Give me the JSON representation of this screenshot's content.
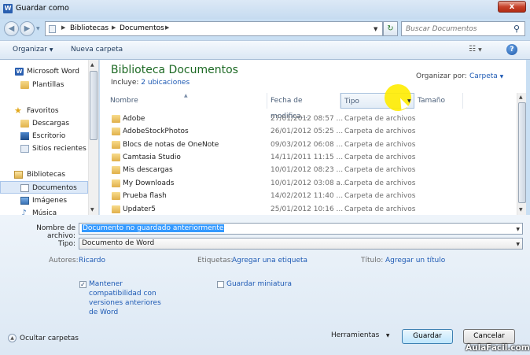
{
  "window": {
    "title": "Guardar como",
    "close_glyph": "x",
    "app_icon": "word-icon"
  },
  "address_bar": {
    "crumbs": [
      "Bibliotecas",
      "Documentos"
    ],
    "search_placeholder": "Buscar Documentos"
  },
  "toolbar": {
    "organize": "Organizar",
    "new_folder": "Nueva carpeta"
  },
  "nav": {
    "items": [
      {
        "label": "Microsoft Word",
        "icon": "word-icon"
      },
      {
        "label": "Plantillas",
        "icon": "folder-icon"
      },
      {
        "label": "Favoritos",
        "icon": "star-icon"
      },
      {
        "label": "Descargas",
        "icon": "downloads-icon"
      },
      {
        "label": "Escritorio",
        "icon": "desktop-icon"
      },
      {
        "label": "Sitios recientes",
        "icon": "recent-places-icon"
      },
      {
        "label": "Bibliotecas",
        "icon": "libraries-icon"
      },
      {
        "label": "Documentos",
        "icon": "documents-icon",
        "selected": true
      },
      {
        "label": "Imágenes",
        "icon": "images-icon"
      },
      {
        "label": "Música",
        "icon": "music-icon"
      }
    ]
  },
  "library": {
    "title": "Biblioteca Documentos",
    "includes_label": "Incluye:",
    "includes_link": "2 ubicaciones",
    "arrange_label": "Organizar por:",
    "arrange_value": "Carpeta"
  },
  "columns": {
    "name": "Nombre",
    "date": "Fecha de modifica...",
    "type": "Tipo",
    "size": "Tamaño"
  },
  "files": [
    {
      "name": "Adobe",
      "date": "27/01/2012 08:57 ...",
      "type": "Carpeta de archivos"
    },
    {
      "name": "AdobeStockPhotos",
      "date": "26/01/2012 05:25 ...",
      "type": "Carpeta de archivos"
    },
    {
      "name": "Blocs de notas de OneNote",
      "date": "09/03/2012 06:08 ...",
      "type": "Carpeta de archivos"
    },
    {
      "name": "Camtasia Studio",
      "date": "14/11/2011 11:15 ...",
      "type": "Carpeta de archivos"
    },
    {
      "name": "Mis descargas",
      "date": "10/01/2012 08:23 ...",
      "type": "Carpeta de archivos"
    },
    {
      "name": "My Downloads",
      "date": "10/01/2012 03:08 a...",
      "type": "Carpeta de archivos"
    },
    {
      "name": "Prueba flash",
      "date": "14/02/2012 11:40 ...",
      "type": "Carpeta de archivos"
    },
    {
      "name": "Updater5",
      "date": "25/01/2012 10:16 ...",
      "type": "Carpeta de archivos"
    }
  ],
  "form": {
    "filename_label": "Nombre de archivo:",
    "filename_value": "Documento no guardado anteriormente",
    "type_label": "Tipo:",
    "type_value": "Documento de Word",
    "authors_label": "Autores:",
    "authors_value": "Ricardo",
    "tags_label": "Etiquetas:",
    "tags_value": "Agregar una etiqueta",
    "title_label": "Título:",
    "title_value": "Agregar un título",
    "compat_checkbox": {
      "line1": "Mantener",
      "line2": "compatibilidad con",
      "line3": "versiones anteriores",
      "line4": "de Word",
      "checked": true
    },
    "thumb_checkbox": {
      "label": "Guardar miniatura",
      "checked": false
    }
  },
  "footer": {
    "hide_folders": "Ocultar carpetas",
    "tools": "Herramientas",
    "save": "Guardar",
    "cancel": "Cancelar"
  },
  "watermark": "AulaFacil.com"
}
